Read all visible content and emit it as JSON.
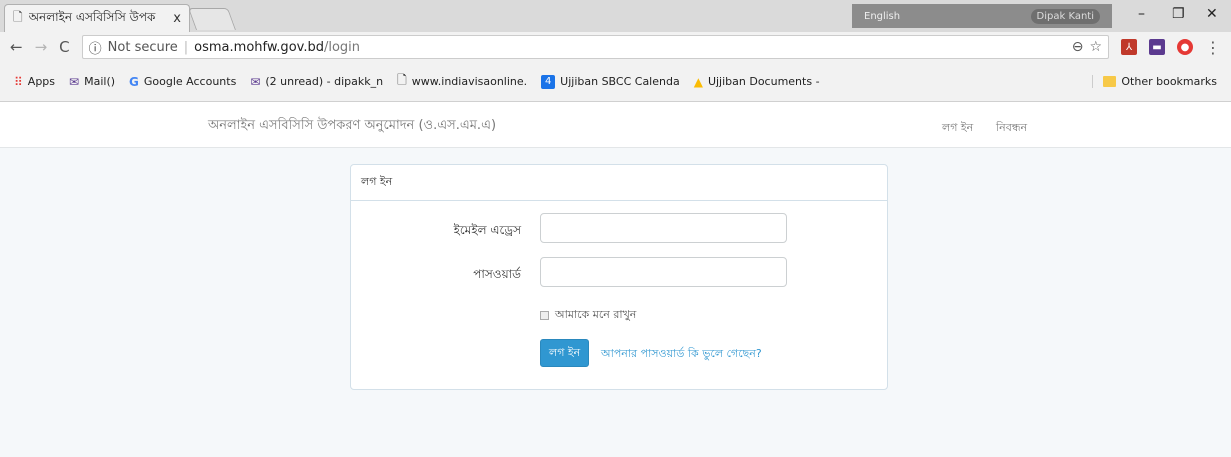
{
  "browser": {
    "tab_title": "অনলাইন এসবিসিসি উপক",
    "tab_close": "x",
    "icons": [
      "doc-icon",
      "close-icon",
      "back-icon",
      "forward-icon",
      "reload-icon",
      "info-icon",
      "zoom-icon",
      "star-icon",
      "menu-dots-icon"
    ],
    "window_strip": {
      "language": "English",
      "user": "Dipak Kanti"
    },
    "address": {
      "not_secure": "Not secure",
      "host": "osma.mohfw.gov.bd",
      "path": "/login"
    }
  },
  "bookmarks": [
    {
      "label": "Apps",
      "icon": "apps-icon"
    },
    {
      "label": "Mail()",
      "icon": "mail-icon"
    },
    {
      "label": "Google Accounts",
      "icon": "google-icon"
    },
    {
      "label": "(2 unread) - dipakk_n",
      "icon": "mail-icon"
    },
    {
      "label": "www.indiavisaonline.",
      "icon": "doc-icon"
    },
    {
      "label": "Ujjiban SBCC Calenda",
      "icon": "calendar-icon",
      "badge": "4"
    },
    {
      "label": "Ujjiban Documents -",
      "icon": "drive-icon"
    }
  ],
  "other_bookmarks": "Other bookmarks",
  "site": {
    "brand": "অনলাইন এসবিসিসি উপকরণ অনুমোদন (ও.এস.এম.এ)",
    "nav_login": "লগ ইন",
    "nav_register": "নিবন্ধন"
  },
  "login": {
    "heading": "লগ ইন",
    "email_label": "ইমেইল এড্রেস",
    "email_value": "",
    "password_label": "পাসওয়ার্ড",
    "password_value": "",
    "remember_label": "আমাকে মনে রাখুন",
    "remember_checked": false,
    "submit_label": "লগ ইন",
    "forgot_link": "আপনার পাসওয়ার্ড কি ভুলে গেছেন?"
  },
  "colors": {
    "page_bg": "#f5f8fa",
    "primary": "#3097d1",
    "panel_border": "#d3e0e9"
  }
}
